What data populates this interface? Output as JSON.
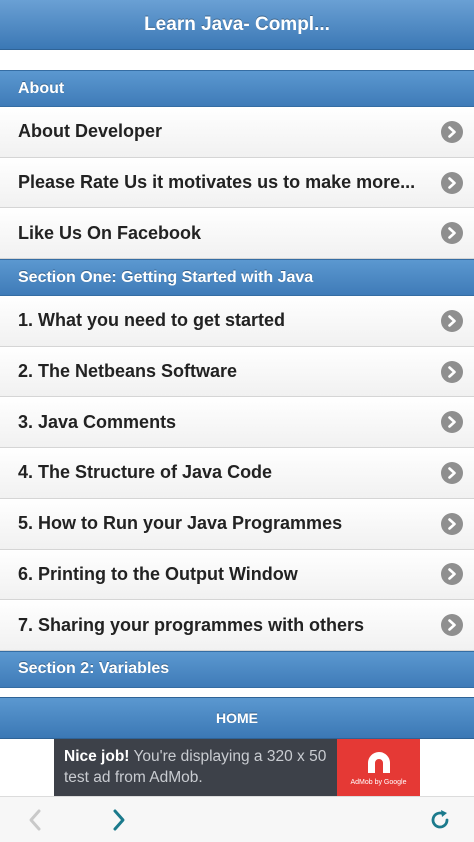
{
  "header": {
    "title": "Learn Java- Compl..."
  },
  "sections": [
    {
      "title": "About",
      "items": [
        {
          "label": "About Developer"
        },
        {
          "label": "Please Rate Us it motivates us to make more..."
        },
        {
          "label": "Like Us On Facebook"
        }
      ]
    },
    {
      "title": "Section One: Getting Started with Java",
      "items": [
        {
          "label": "1. What you need to get started"
        },
        {
          "label": "2. The Netbeans Software"
        },
        {
          "label": "3. Java Comments"
        },
        {
          "label": "4. The Structure of Java Code"
        },
        {
          "label": "5. How to Run your Java Programmes"
        },
        {
          "label": "6. Printing to the Output Window"
        },
        {
          "label": "7. Sharing your programmes with others"
        }
      ]
    },
    {
      "title": "Section 2: Variables",
      "items": []
    }
  ],
  "home": {
    "label": "HOME"
  },
  "ad": {
    "headline": "Nice job!",
    "body": " You're displaying a 320 x 50 test ad from AdMob.",
    "logo_caption": "AdMob by Google"
  },
  "colors": {
    "accent": "#3f7bb8",
    "chevron": "#8f8f8f",
    "ad_red": "#e53935",
    "nav_teal": "#1b7a8c"
  },
  "icons": {
    "back": "chevron-left-icon",
    "forward": "chevron-right-icon",
    "refresh": "refresh-icon",
    "row": "chevron-right-circle-icon"
  }
}
